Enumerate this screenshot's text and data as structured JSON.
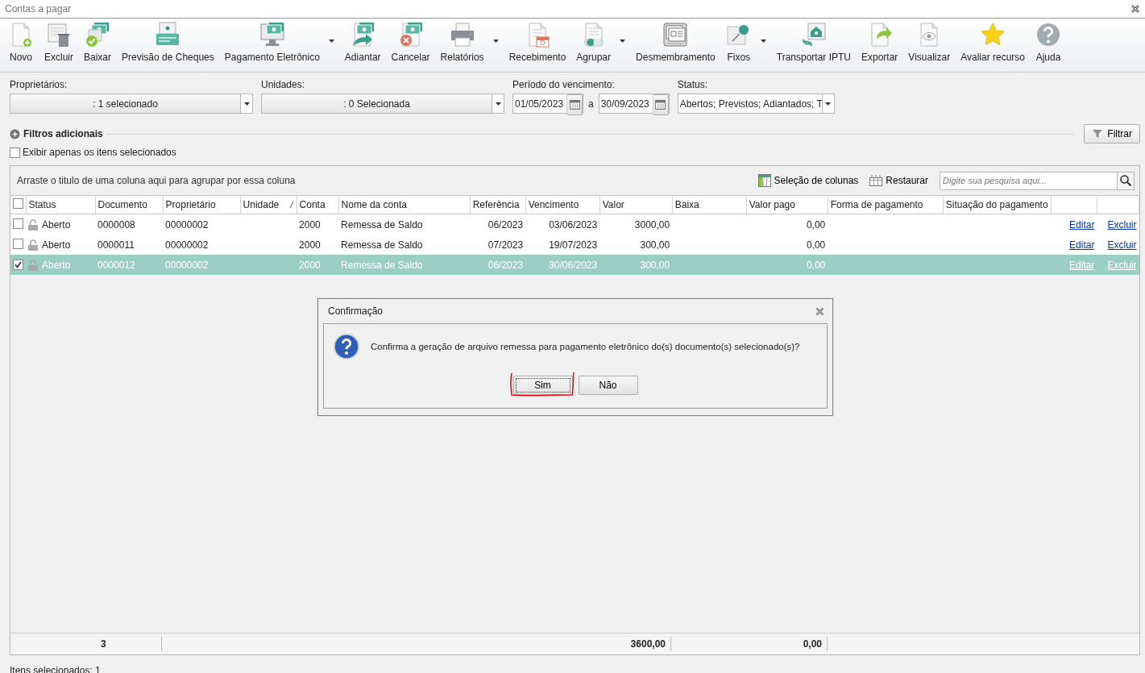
{
  "window": {
    "title": "Contas a pagar"
  },
  "toolbar": [
    {
      "label": "Novo",
      "kind": "new",
      "has_menu": false
    },
    {
      "label": "Excluir",
      "kind": "delete",
      "has_menu": false
    },
    {
      "label": "Baixar",
      "kind": "settle",
      "has_menu": false
    },
    {
      "label": "Previsão de Cheques",
      "kind": "cheque",
      "has_menu": false
    },
    {
      "label": "Pagamento Eletrônico",
      "kind": "monitor",
      "has_menu": true
    },
    {
      "label": "Adiantar",
      "kind": "advance",
      "has_menu": false
    },
    {
      "label": "Cancelar",
      "kind": "cancel",
      "has_menu": false
    },
    {
      "label": "Relatórios",
      "kind": "printer",
      "has_menu": true
    },
    {
      "label": "Recebimento",
      "kind": "calendar",
      "has_menu": false
    },
    {
      "label": "Agrupar",
      "kind": "group",
      "has_menu": true
    },
    {
      "label": "Desmembramento",
      "kind": "stack",
      "has_menu": false
    },
    {
      "label": "Fixos",
      "kind": "pin",
      "has_menu": true
    },
    {
      "label": "Transportar IPTU",
      "kind": "house",
      "has_menu": false
    },
    {
      "label": "Exportar",
      "kind": "export",
      "has_menu": false
    },
    {
      "label": "Visualizar",
      "kind": "view",
      "has_menu": false
    },
    {
      "label": "Avaliar recurso",
      "kind": "star",
      "has_menu": false
    },
    {
      "label": "Ajuda",
      "kind": "help",
      "has_menu": false
    }
  ],
  "filters": {
    "owners": {
      "label": "Proprietários:",
      "value": ": 1 selecionado"
    },
    "units": {
      "label": "Unidades:",
      "value": ": 0 Selecionada"
    },
    "period": {
      "label": "Período do vencimento:",
      "from": "01/05/2023",
      "separator": "a",
      "to": "30/09/2023"
    },
    "status": {
      "label": "Status:",
      "value": "Abertos; Previstos; Adiantados; T"
    }
  },
  "extra_filters": {
    "label": "Filtros adicionais"
  },
  "filter_button": {
    "label": "Filtrar"
  },
  "show_selected": {
    "label": "Exibir apenas os itens selecionados",
    "checked": false
  },
  "grid": {
    "group_hint": "Arraste o titulo de uma coluna aqui para agrupar por essa coluna",
    "column_select": "Seleção de colunas",
    "restore": "Restaurar",
    "search": {
      "placeholder": "Digite sua pesquisa aqui..."
    },
    "all_checked": false,
    "columns": [
      {
        "label": "Status"
      },
      {
        "label": "Documento"
      },
      {
        "label": "Proprietário"
      },
      {
        "label": "Unidade",
        "sorted": true
      },
      {
        "label": "Conta"
      },
      {
        "label": "Nome da conta"
      },
      {
        "label": "Referência"
      },
      {
        "label": "Vencimento"
      },
      {
        "label": "Valor"
      },
      {
        "label": "Baixa"
      },
      {
        "label": "Valor pago"
      },
      {
        "label": "Forma de pagamento"
      },
      {
        "label": "Situação do pagamento"
      }
    ],
    "rows": [
      {
        "checked": false,
        "selected": false,
        "status": "Aberto",
        "documento": "0000008",
        "proprietario": "00000002",
        "conta": "2000",
        "nome": "Remessa de Saldo",
        "referencia": "06/2023",
        "vencimento": "03/06/2023",
        "valor": "3000,00",
        "valor_pago": "0,00",
        "edit": "Editar",
        "delete": "Excluir"
      },
      {
        "checked": false,
        "selected": false,
        "status": "Aberto",
        "documento": "0000011",
        "proprietario": "00000002",
        "conta": "2000",
        "nome": "Remessa de Saldo",
        "referencia": "07/2023",
        "vencimento": "19/07/2023",
        "valor": "300,00",
        "valor_pago": "0,00",
        "edit": "Editar",
        "delete": "Excluir"
      },
      {
        "checked": true,
        "selected": true,
        "status": "Aberto",
        "documento": "0000012",
        "proprietario": "00000002",
        "conta": "2000",
        "nome": "Remessa de Saldo",
        "referencia": "06/2023",
        "vencimento": "30/06/2023",
        "valor": "300,00",
        "valor_pago": "0,00",
        "edit": "Editar",
        "delete": "Excluir"
      }
    ],
    "totals": {
      "count": "3",
      "valor": "3600,00",
      "valor_pago": "0,00"
    }
  },
  "dialog": {
    "title": "Confirmação",
    "message": "Confirma a geração de arquivo remessa para pagamento eletrônico do(s) documento(s) selecionado(s)?",
    "buttons": [
      {
        "label": "Sim",
        "focused": true
      },
      {
        "label": "Não",
        "focused": false
      }
    ]
  },
  "status_bar": "Itens selecionados: 1"
}
